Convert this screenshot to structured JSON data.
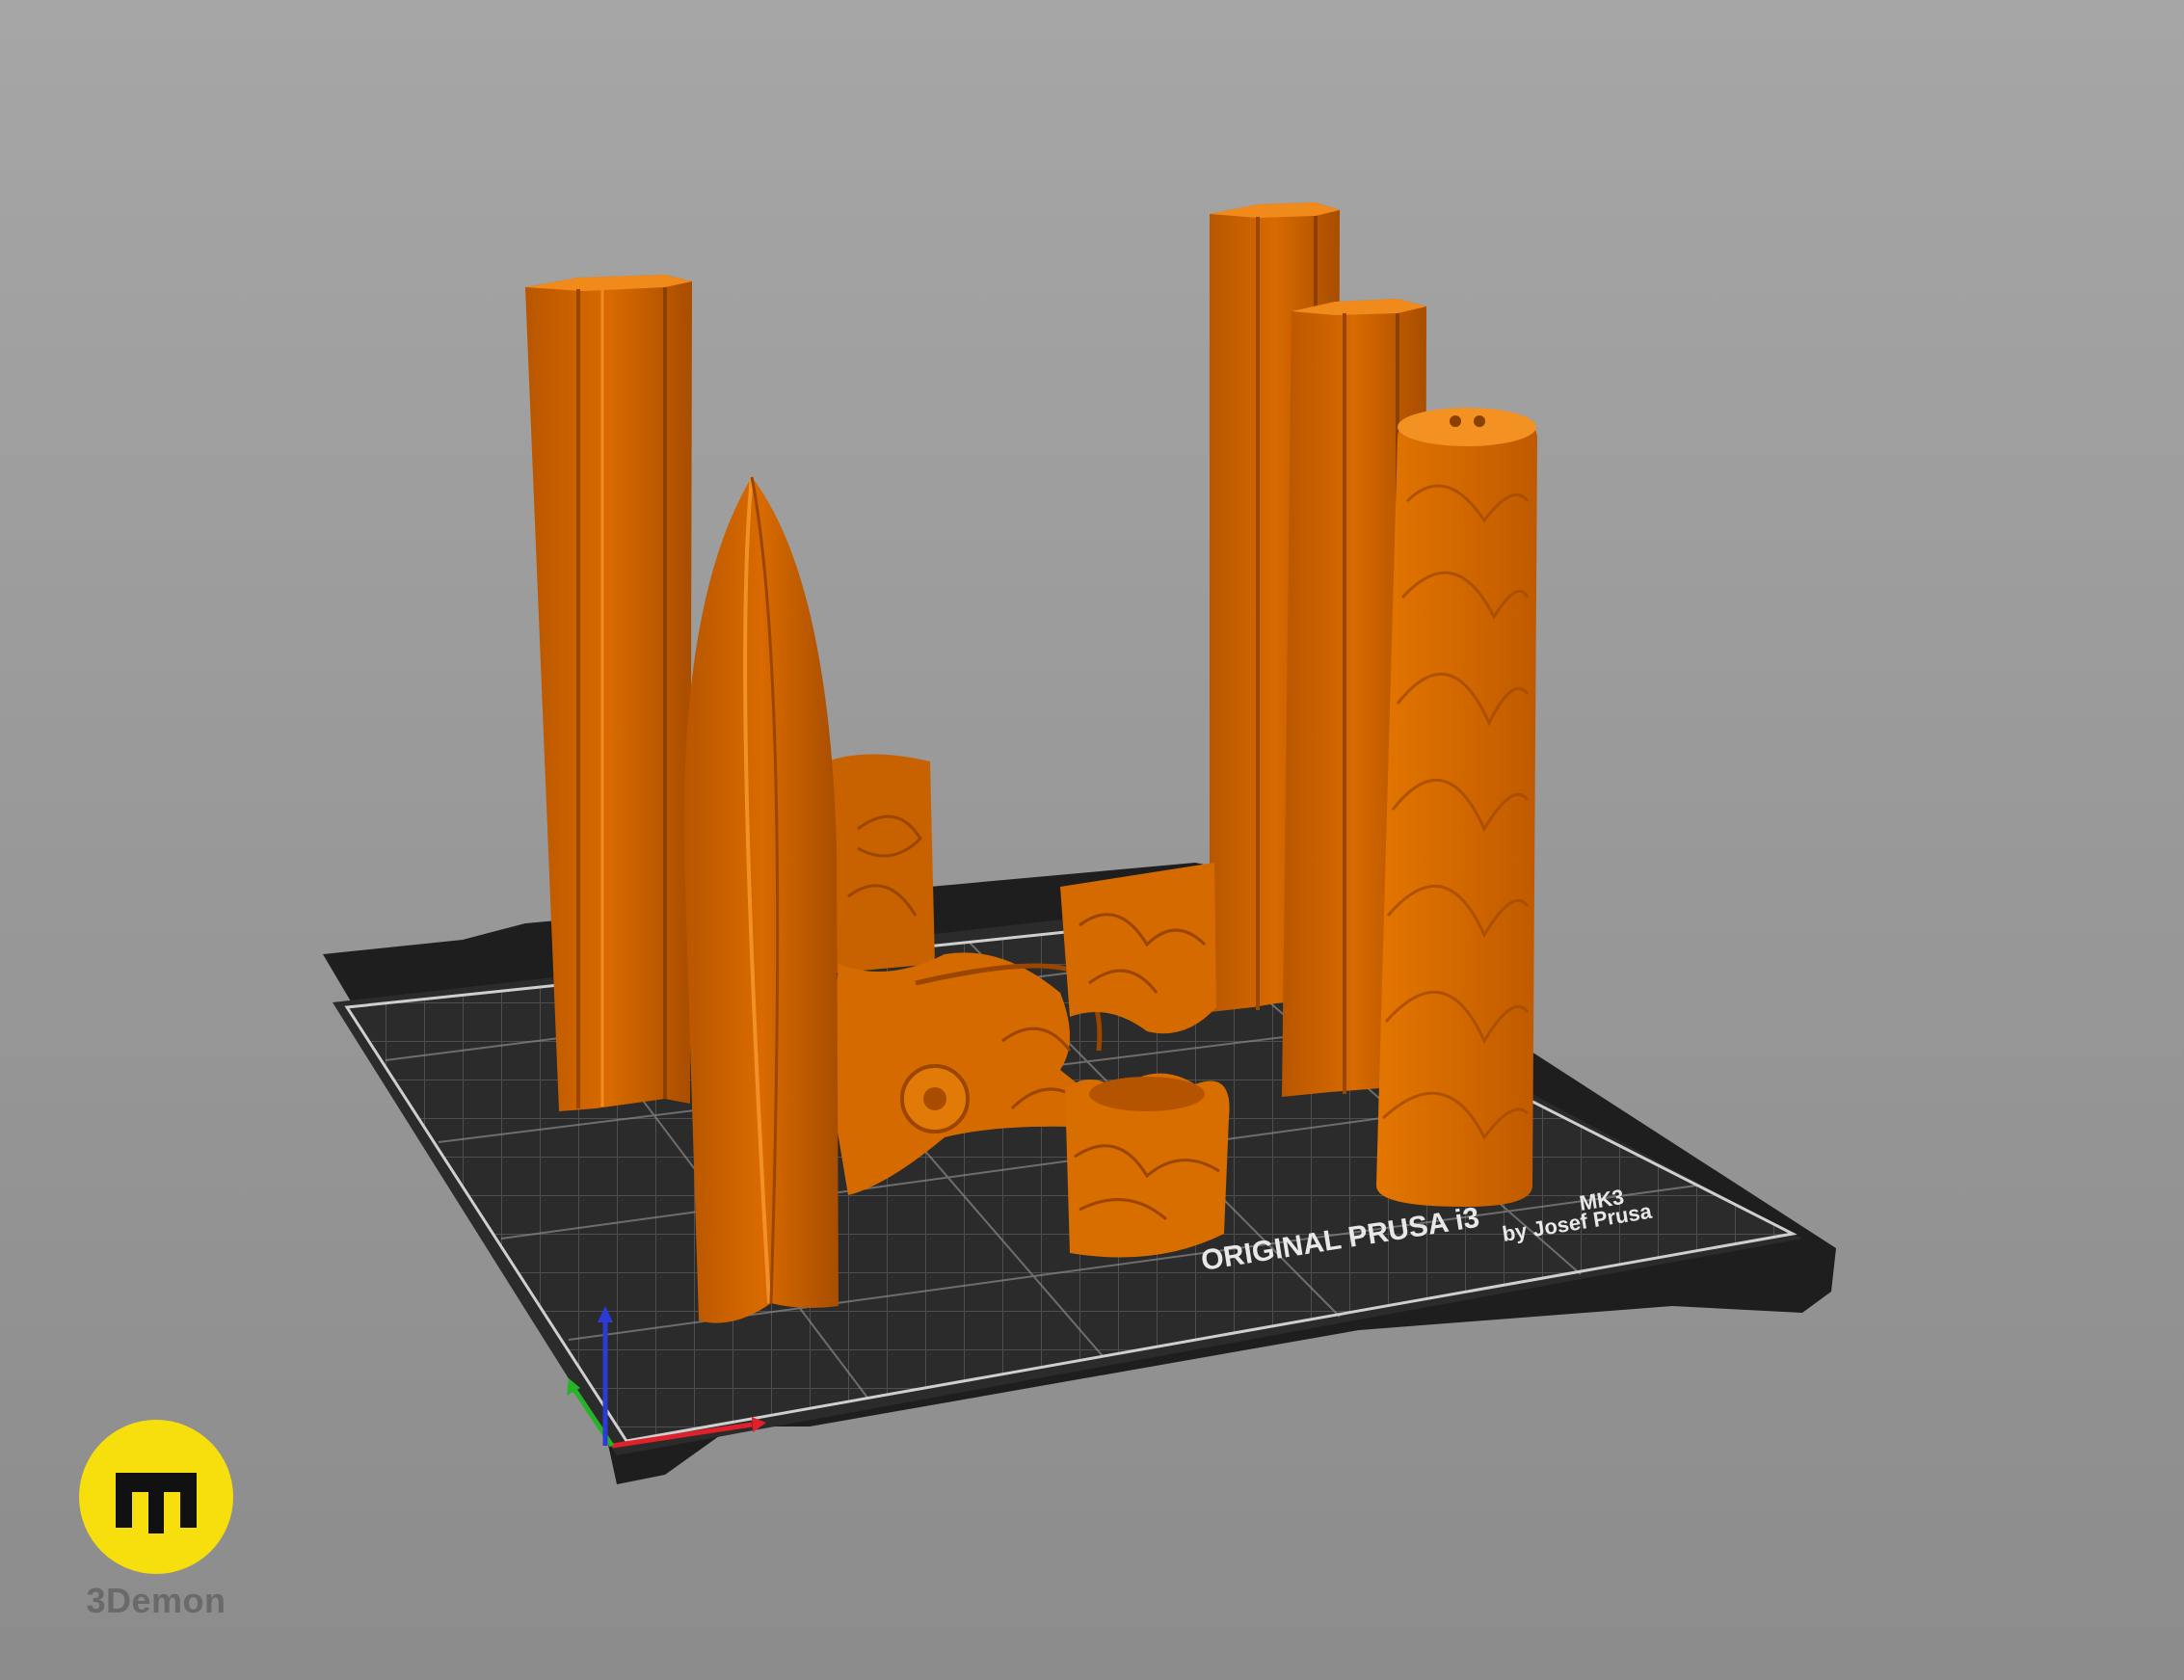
{
  "viewport": {
    "bed_label_main": "ORIGINAL PRUSA i3",
    "bed_label_model": "MK3",
    "bed_label_sub": "by Josef Prusa",
    "background_color": "#9a9a9a",
    "model_color": "#e07100",
    "bed_color": "#2b2b2b"
  },
  "axes": {
    "x_color": "#e0202a",
    "y_color": "#27b327",
    "z_color": "#2a3bd6"
  },
  "brand": {
    "name": "3Demon",
    "logo_icon": "3demon-logo-icon",
    "logo_color": "#f6df0c"
  }
}
